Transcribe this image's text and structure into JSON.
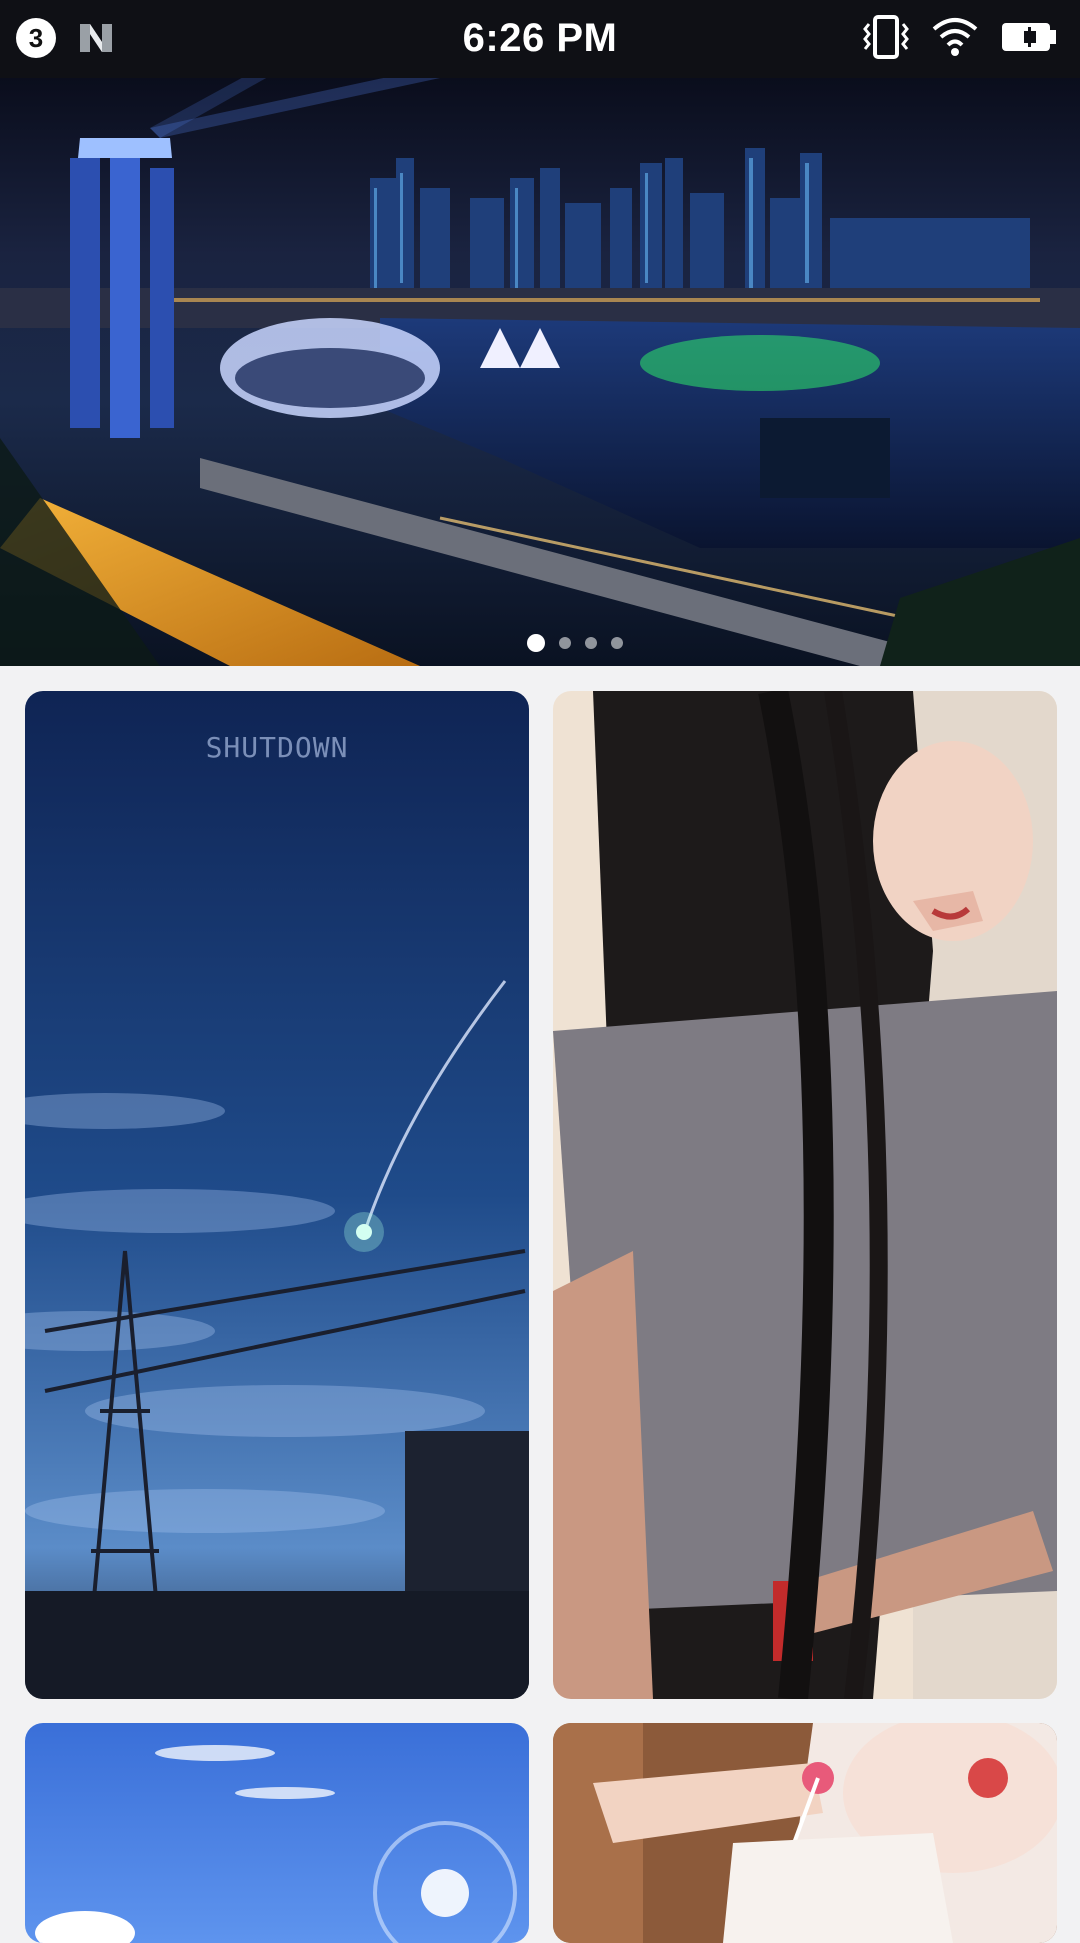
{
  "status_bar": {
    "notification_count": "3",
    "time": "6:26 PM",
    "icons": [
      "n-app-icon",
      "vibrate-icon",
      "wifi-icon",
      "battery-charging-icon"
    ]
  },
  "banner": {
    "image": "city-night-skyline",
    "page_indicator": {
      "count": 4,
      "active_index": 0
    }
  },
  "grid": {
    "items": [
      {
        "image": "night-sky-shooting-star",
        "caption": "SHUTDOWN"
      },
      {
        "image": "anime-girl-long-hair"
      },
      {
        "image": "blue-sky-sun"
      },
      {
        "image": "anime-girl-lollipop"
      }
    ]
  },
  "colors": {
    "status_bar": "#0f1015",
    "page_background": "#f2f2f3",
    "indicator_active": "#ffffff"
  }
}
